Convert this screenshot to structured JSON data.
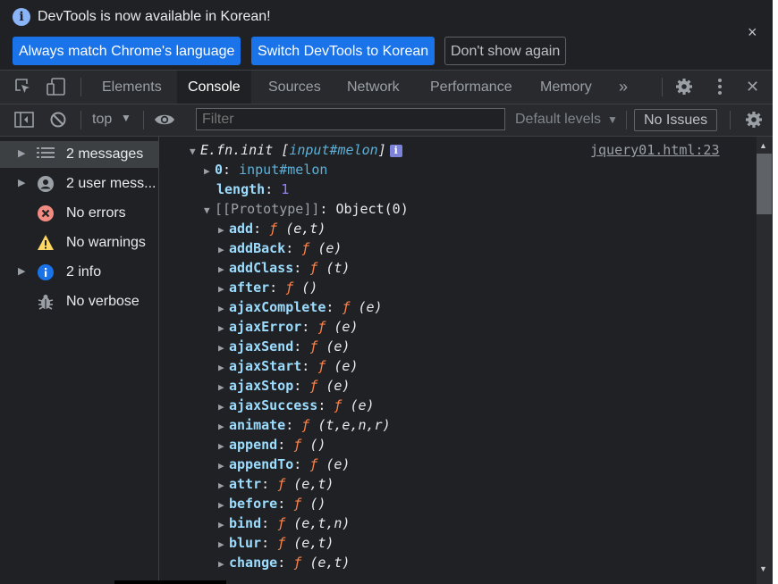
{
  "infobar": {
    "message": "DevTools is now available in Korean!",
    "btn_match": "Always match Chrome's language",
    "btn_switch": "Switch DevTools to Korean",
    "btn_dismiss": "Don't show again",
    "close": "×"
  },
  "tabs": [
    {
      "label": "Elements"
    },
    {
      "label": "Console"
    },
    {
      "label": "Sources"
    },
    {
      "label": "Network"
    },
    {
      "label": "Performance"
    },
    {
      "label": "Memory"
    }
  ],
  "tabbar": {
    "more": "»",
    "close": "✕"
  },
  "console_toolbar": {
    "context": "top",
    "filter_placeholder": "Filter",
    "levels": "Default levels",
    "issues": "No Issues"
  },
  "sidebar": [
    {
      "label": "2 messages",
      "icon": "list-icon"
    },
    {
      "label": "2 user mess...",
      "icon": "user-icon"
    },
    {
      "label": "No errors",
      "icon": "error-icon"
    },
    {
      "label": "No warnings",
      "icon": "warning-icon"
    },
    {
      "label": "2 info",
      "icon": "info-icon"
    },
    {
      "label": "No verbose",
      "icon": "bug-icon"
    }
  ],
  "log": {
    "header_name": "E.fn.init",
    "header_open": "[",
    "header_el": "input#melon",
    "header_close": "]",
    "source": "jquery01.html:23",
    "entry0_key": "0",
    "entry0_value": "input#melon",
    "length_key": "length",
    "length_value": "1",
    "proto_key": "[[Prototype]]",
    "proto_value": "Object(0)",
    "methods": [
      {
        "name": "add",
        "params": "(e,t)"
      },
      {
        "name": "addBack",
        "params": "(e)"
      },
      {
        "name": "addClass",
        "params": "(t)"
      },
      {
        "name": "after",
        "params": "()"
      },
      {
        "name": "ajaxComplete",
        "params": "(e)"
      },
      {
        "name": "ajaxError",
        "params": "(e)"
      },
      {
        "name": "ajaxSend",
        "params": "(e)"
      },
      {
        "name": "ajaxStart",
        "params": "(e)"
      },
      {
        "name": "ajaxStop",
        "params": "(e)"
      },
      {
        "name": "ajaxSuccess",
        "params": "(e)"
      },
      {
        "name": "animate",
        "params": "(t,e,n,r)"
      },
      {
        "name": "append",
        "params": "()"
      },
      {
        "name": "appendTo",
        "params": "(e)"
      },
      {
        "name": "attr",
        "params": "(e,t)"
      },
      {
        "name": "before",
        "params": "()"
      },
      {
        "name": "bind",
        "params": "(e,t,n)"
      },
      {
        "name": "blur",
        "params": "(e,t)"
      },
      {
        "name": "change",
        "params": "(e,t)"
      }
    ]
  },
  "colors": {
    "accent": "#1a73e8",
    "panel_bg": "#202124",
    "key": "#9cdcfe",
    "function": "#ff8247",
    "element": "#5db0d7",
    "number": "#9980ff"
  }
}
